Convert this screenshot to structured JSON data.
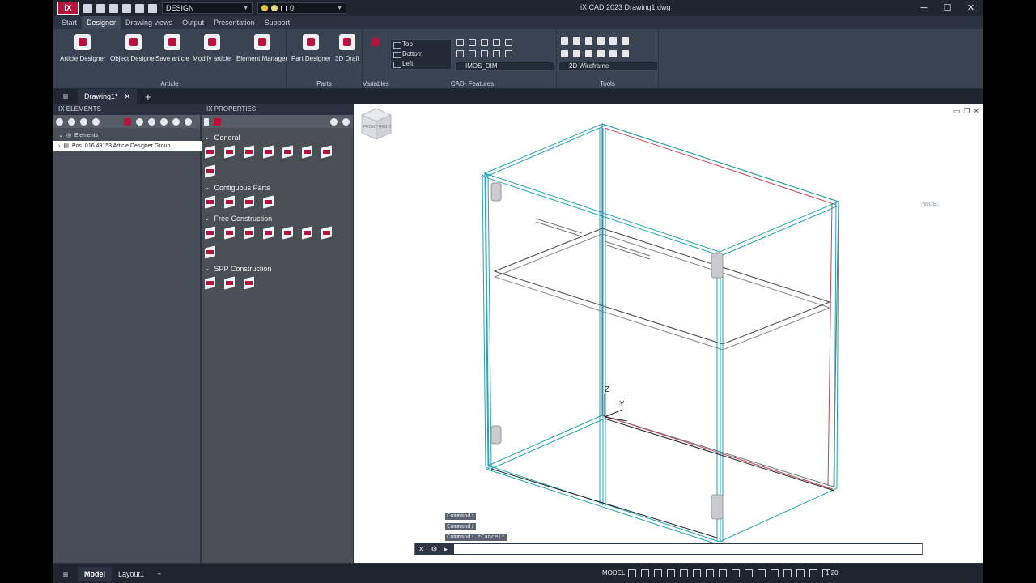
{
  "titlebar": {
    "logo": "iX",
    "workspace": "DESIGN",
    "layer": "0",
    "title": "iX CAD 2023    Drawing1.dwg",
    "minimize": "─",
    "maximize": "☐",
    "close": "✕"
  },
  "tabs": [
    "Start",
    "Designer",
    "Drawing views",
    "Output",
    "Presentation",
    "Support"
  ],
  "active_tab": "Designer",
  "ribbon": {
    "article": {
      "title": "Article",
      "buttons": [
        "Article Designer",
        "Object Designer",
        "Save article",
        "Modify article",
        "Element Manager"
      ]
    },
    "parts": {
      "title": "Parts",
      "buttons": [
        "Part Designer",
        "3D Draft"
      ]
    },
    "variables": {
      "title": "Variables"
    },
    "cad": {
      "title": "CAD- Features",
      "views": [
        "Top",
        "Bottom",
        "Left"
      ],
      "dimstyle": "IMOS_DIM"
    },
    "tools": {
      "title": "Tools",
      "visual_style": "2D Wireframe"
    }
  },
  "document": {
    "tab": "Drawing1*",
    "close": "✕",
    "add": "+"
  },
  "elements_panel": {
    "title": "IX ELEMENTS",
    "root": "Elements",
    "item": "Pos. 016 49153 Article Designer Group"
  },
  "properties_panel": {
    "title": "IX PROPERTIES",
    "sections": [
      "General",
      "Contiguous Parts",
      "Free Construction",
      "SPP Construction"
    ]
  },
  "viewport": {
    "wcs": "WCS",
    "viewcube_front": "FRONT",
    "viewcube_right": "RIGHT",
    "axis_z": "Z",
    "axis_y": "Y",
    "cmd_history": [
      "Command:",
      "Command:",
      "Command: *Cancel*"
    ]
  },
  "statusbar": {
    "model_tab": "Model",
    "layout_tab": "Layout1",
    "add": "+",
    "mode": "MODEL",
    "scale": "1:20"
  },
  "colors": {
    "accent": "#b8123a",
    "cad_cyan": "#1fa3b8",
    "cad_red": "#c0485a"
  }
}
